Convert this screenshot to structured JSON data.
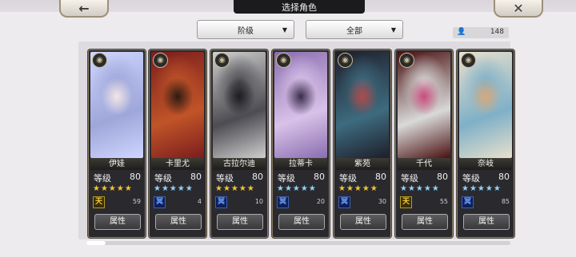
{
  "header": {
    "title": "选择角色",
    "back_icon": "left-arrow-icon",
    "close_icon": "close-icon"
  },
  "filters": {
    "rank_label": "阶级",
    "category_label": "全部"
  },
  "character_count": "148",
  "cards": [
    {
      "name": "伊娃",
      "level_label": "等级",
      "level": "80",
      "star_color": "gold",
      "badge": "天",
      "badge_type": "tian",
      "count": "59",
      "button": "属性",
      "palette": [
        "#cfd5ff",
        "#9ea7d9",
        "#f4e6e6"
      ]
    },
    {
      "name": "卡里尤",
      "level_label": "等级",
      "level": "80",
      "star_color": "blue",
      "badge": "冥",
      "badge_type": "ming",
      "count": "4",
      "button": "属性",
      "palette": [
        "#7a1d1d",
        "#c05428",
        "#2d1a12"
      ]
    },
    {
      "name": "古拉尔迪",
      "level_label": "等级",
      "level": "80",
      "star_color": "gold",
      "badge": "冥",
      "badge_type": "ming",
      "count": "10",
      "button": "属性",
      "palette": [
        "#cfcfcf",
        "#4c4c52",
        "#1c1c20"
      ]
    },
    {
      "name": "拉蒂卡",
      "level_label": "等级",
      "level": "80",
      "star_color": "blue",
      "badge": "冥",
      "badge_type": "ming",
      "count": "20",
      "button": "属性",
      "palette": [
        "#8a6db0",
        "#d8c2e8",
        "#3a2b4a"
      ]
    },
    {
      "name": "紫苑",
      "level_label": "等级",
      "level": "80",
      "star_color": "gold",
      "badge": "冥",
      "badge_type": "ming",
      "count": "30",
      "button": "属性",
      "palette": [
        "#1e1e2a",
        "#3e6b7f",
        "#b04a4a"
      ]
    },
    {
      "name": "千代",
      "level_label": "等级",
      "level": "80",
      "star_color": "blue",
      "badge": "天",
      "badge_type": "tian",
      "count": "55",
      "button": "属性",
      "palette": [
        "#4a1010",
        "#d9d9d9",
        "#c94b7a"
      ]
    },
    {
      "name": "奈岐",
      "level_label": "等级",
      "level": "80",
      "star_color": "blue",
      "badge": "冥",
      "badge_type": "ming",
      "count": "85",
      "button": "属性",
      "palette": [
        "#e8e0cc",
        "#7fb0c8",
        "#d7a87a"
      ]
    }
  ]
}
